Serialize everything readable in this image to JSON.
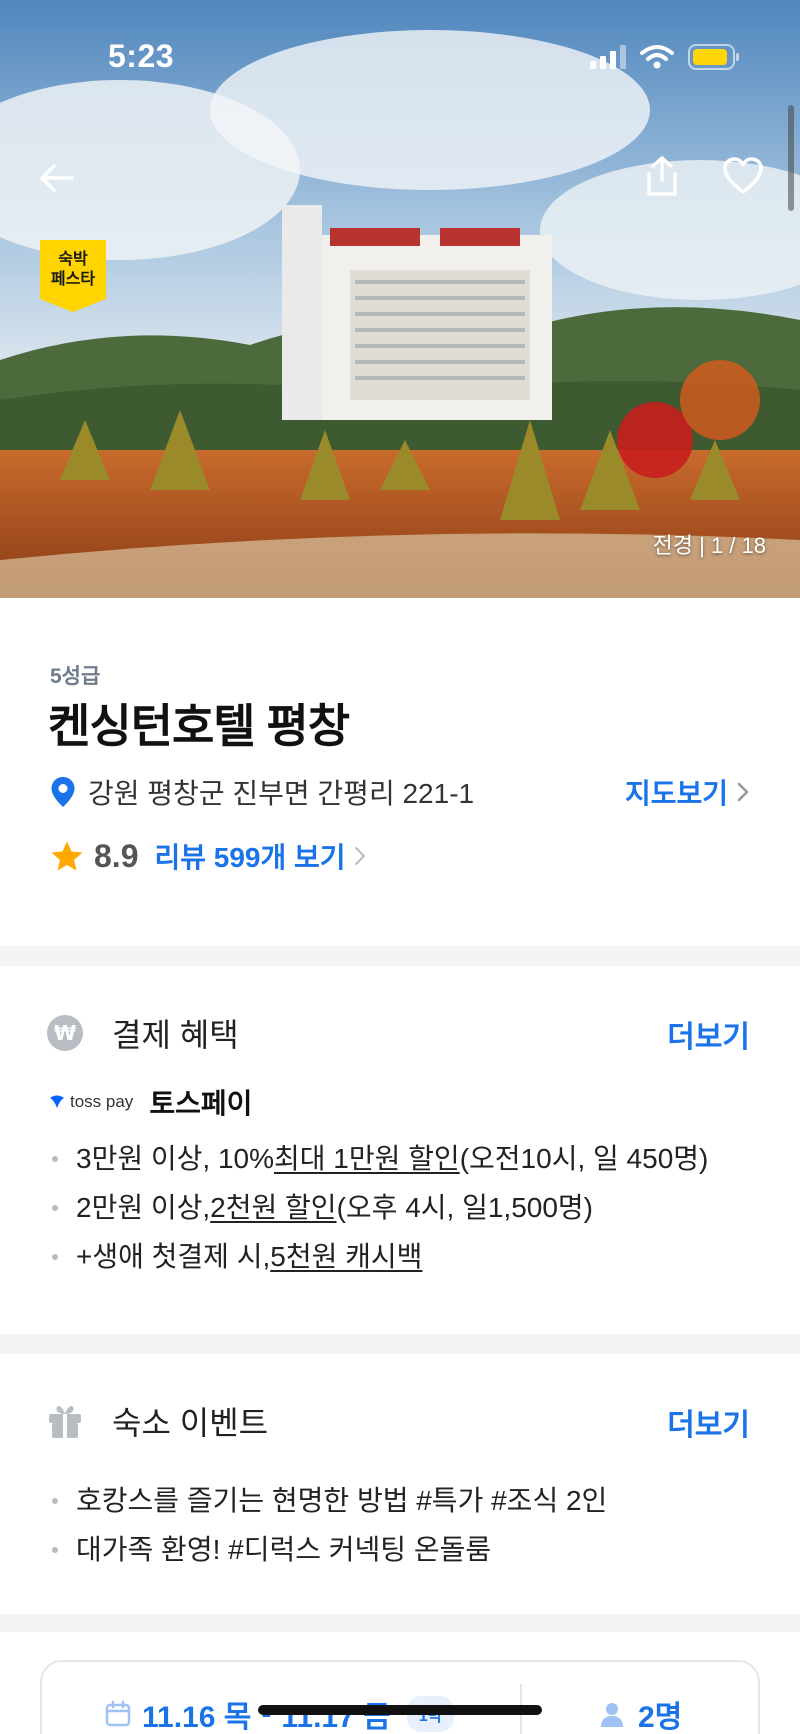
{
  "status": {
    "time": "5:23"
  },
  "hero": {
    "badge_line1": "숙박",
    "badge_line2": "페스타",
    "photo_counter": "전경 | 1 / 18"
  },
  "hotel": {
    "grade": "5성급",
    "name": "켄싱턴호텔 평창",
    "address": "강원 평창군 진부면 간평리 221-1",
    "map_link": "지도보기",
    "rating": "8.9",
    "review_link": "리뷰 599개 보기"
  },
  "payment": {
    "title": "결제 혜택",
    "more": "더보기",
    "provider_logo": "toss pay",
    "provider_name": "토스페이",
    "benefits": [
      {
        "pre": "3만원 이상, 10% ",
        "em": "최대 1만원 할인",
        "post": "(오전10시, 일 450명)"
      },
      {
        "pre": "2만원 이상, ",
        "em": "2천원 할인",
        "post": " (오후 4시, 일1,500명)"
      },
      {
        "pre": "+생애 첫결제 시, ",
        "em": "5천원 캐시백",
        "post": ""
      }
    ]
  },
  "events": {
    "title": "숙소 이벤트",
    "more": "더보기",
    "items": [
      "호캉스를 즐기는 현명한 방법 #특가 #조식 2인",
      "대가족 환영! #디럭스 커넥팅 온돌룸"
    ]
  },
  "booking": {
    "checkin": "11.16 목",
    "separator": "-",
    "checkout": "11.17 금",
    "nights": "1박",
    "guests": "2명"
  },
  "colors": {
    "accent": "#1a73e8",
    "badge": "#ffd400",
    "star": "#ffa800"
  }
}
